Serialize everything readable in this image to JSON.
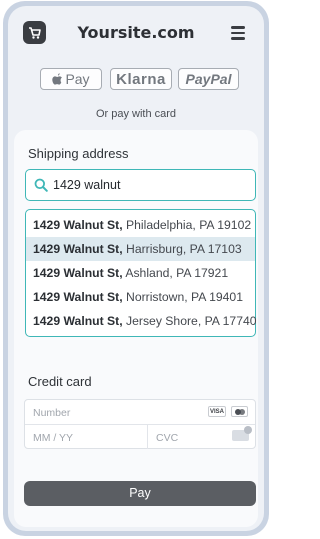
{
  "header": {
    "site_title": "Yoursite.com",
    "logo_icon": "cart-logo-icon",
    "menu_icon": "hamburger-menu-icon"
  },
  "wallets": {
    "apple_pay": "Pay",
    "klarna": "Klarna",
    "paypal": "PayPal"
  },
  "or_pay_with_card": "Or pay with card",
  "shipping": {
    "label": "Shipping address",
    "search_value": "1429 walnut",
    "suggestions": [
      {
        "bold": "1429 Walnut St,",
        "rest": " Philadelphia, PA 19102",
        "active": false
      },
      {
        "bold": "1429 Walnut St,",
        "rest": " Harrisburg, PA 17103",
        "active": true
      },
      {
        "bold": "1429 Walnut St,",
        "rest": " Ashland, PA 17921",
        "active": false
      },
      {
        "bold": "1429 Walnut St,",
        "rest": " Norristown, PA 19401",
        "active": false
      },
      {
        "bold": "1429 Walnut St,",
        "rest": " Jersey Shore, PA 17740",
        "active": false
      }
    ]
  },
  "credit_card": {
    "label": "Credit card",
    "number_placeholder": "Number",
    "expiry_placeholder": "MM / YY",
    "cvc_placeholder": "CVC",
    "visa_text": "VISA"
  },
  "pay_button": "Pay",
  "colors": {
    "accent_teal": "#3fb7b7",
    "button_dark": "#5b5e63",
    "active_row": "#dde9ef"
  }
}
